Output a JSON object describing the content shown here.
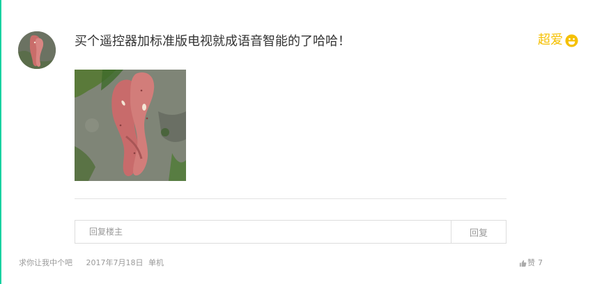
{
  "comment": {
    "text": "买个遥控器加标准版电视就成语音智能的了哈哈！",
    "rating_label": "超爱",
    "rating_icon": "smile-icon",
    "rating_color": "#f5c000",
    "avatar_icon": "sweet-potato-avatar",
    "photo_icon": "sweet-potato-photo"
  },
  "reply": {
    "placeholder": "回复楼主",
    "button_label": "回复"
  },
  "meta": {
    "username": "求你让我中个吧",
    "date": "2017年7月18日",
    "source": "单机"
  },
  "like": {
    "label": "赞",
    "count": "7",
    "icon": "thumb-up-icon"
  },
  "colors": {
    "accent": "#19d1a1",
    "text": "#333333",
    "muted": "#999999",
    "border": "#dddddd"
  }
}
